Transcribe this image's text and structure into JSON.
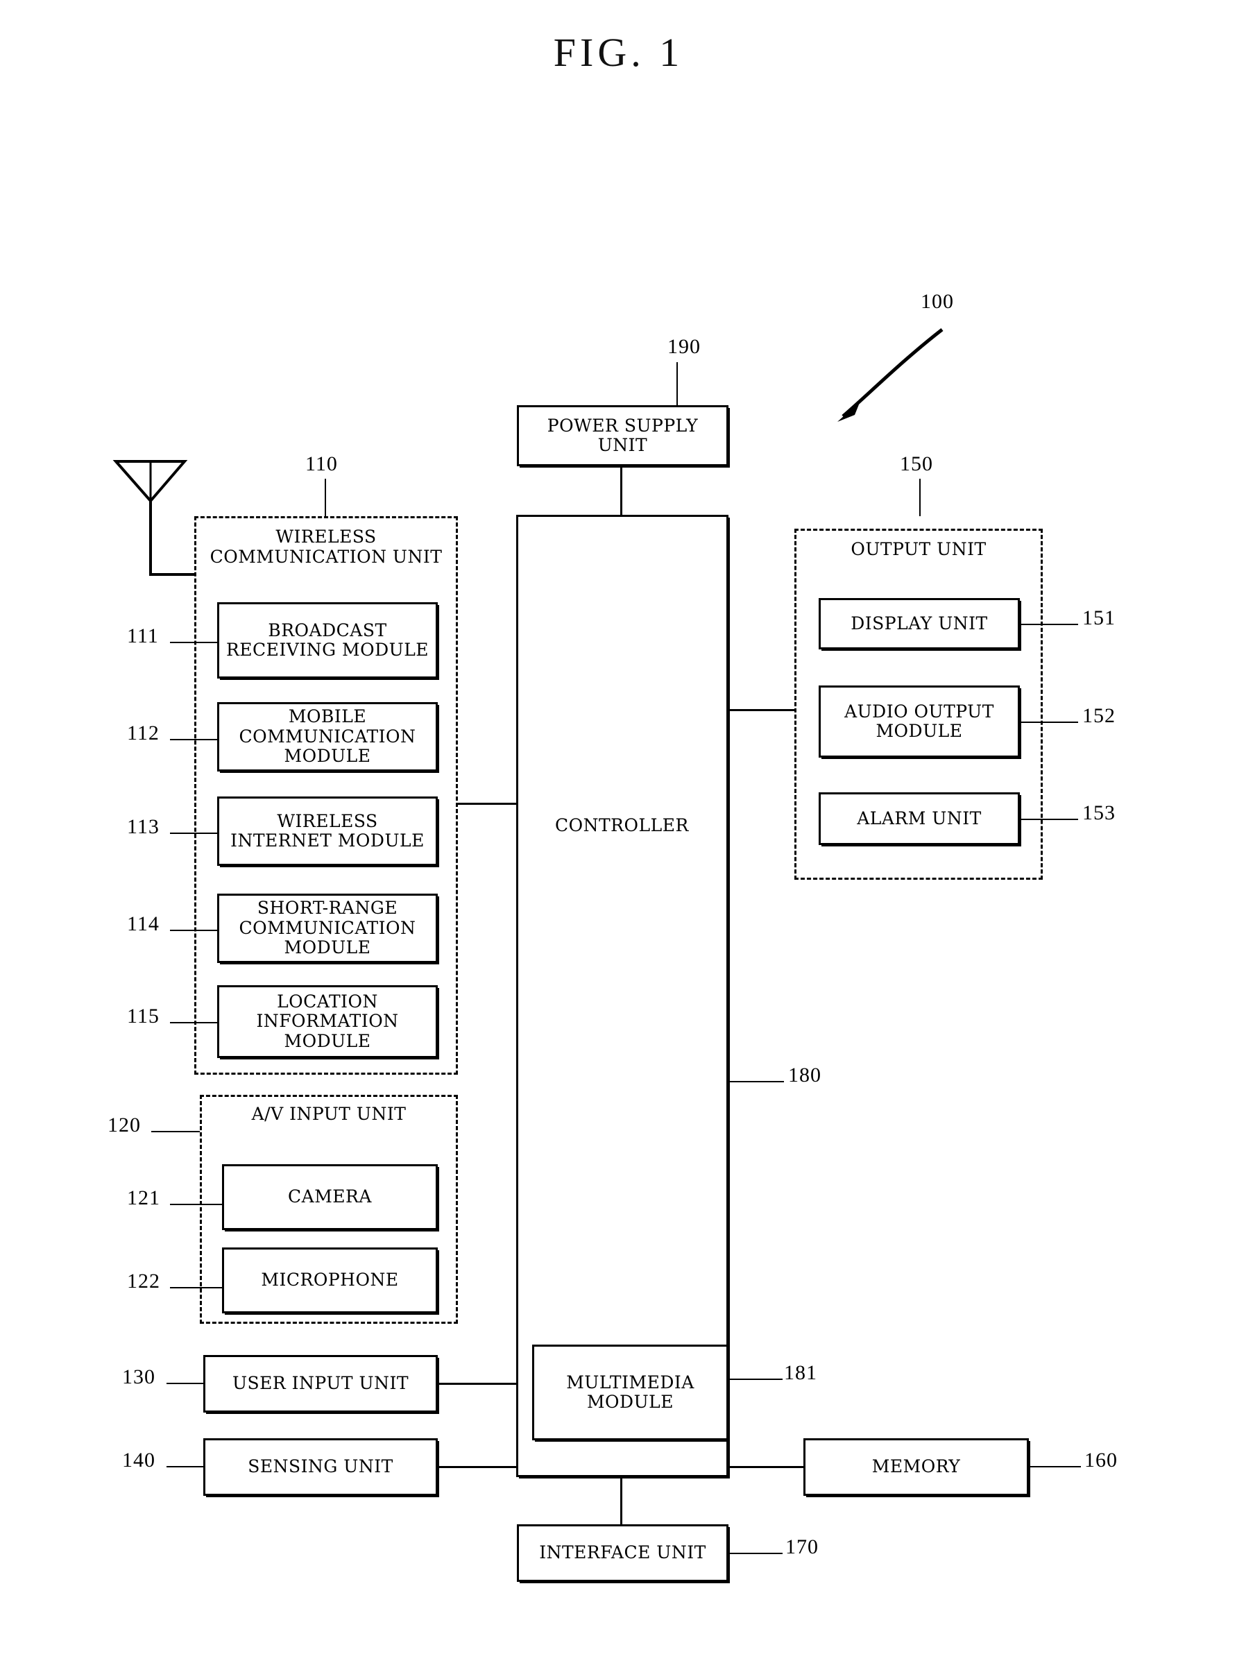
{
  "figure": {
    "title": "FIG.  1",
    "system_ref": "100"
  },
  "power_supply": {
    "label": "POWER SUPPLY\nUNIT",
    "ref": "190"
  },
  "wireless_unit": {
    "label": "WIRELESS\nCOMMUNICATION UNIT",
    "ref": "110",
    "modules": [
      {
        "label": "BROADCAST\nRECEIVING MODULE",
        "ref": "111"
      },
      {
        "label": "MOBILE\nCOMMUNICATION MODULE",
        "ref": "112"
      },
      {
        "label": "WIRELESS\nINTERNET MODULE",
        "ref": "113"
      },
      {
        "label": "SHORT-RANGE\nCOMMUNICATION MODULE",
        "ref": "114"
      },
      {
        "label": "LOCATION\nINFORMATION MODULE",
        "ref": "115"
      }
    ]
  },
  "av_input_unit": {
    "label": "A/V INPUT UNIT",
    "ref": "120",
    "modules": [
      {
        "label": "CAMERA",
        "ref": "121"
      },
      {
        "label": "MICROPHONE",
        "ref": "122"
      }
    ]
  },
  "user_input_unit": {
    "label": "USER INPUT UNIT",
    "ref": "130"
  },
  "sensing_unit": {
    "label": "SENSING UNIT",
    "ref": "140"
  },
  "controller": {
    "label": "CONTROLLER",
    "ref": "180",
    "multimedia_module": {
      "label": "MULTIMEDIA\nMODULE",
      "ref": "181"
    }
  },
  "output_unit": {
    "label": "OUTPUT UNIT",
    "ref": "150",
    "modules": [
      {
        "label": "DISPLAY UNIT",
        "ref": "151"
      },
      {
        "label": "AUDIO OUTPUT\nMODULE",
        "ref": "152"
      },
      {
        "label": "ALARM UNIT",
        "ref": "153"
      }
    ]
  },
  "memory": {
    "label": "MEMORY",
    "ref": "160"
  },
  "interface_unit": {
    "label": "INTERFACE UNIT",
    "ref": "170"
  },
  "icons": {
    "antenna": "antenna-icon",
    "system_pointer": "curved-arrow-icon"
  }
}
